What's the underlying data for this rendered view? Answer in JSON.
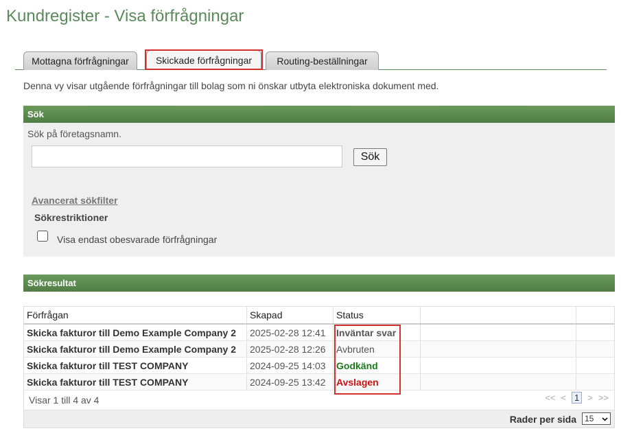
{
  "page_title": "Kundregister - Visa förfrågningar",
  "tabs": [
    {
      "label": "Mottagna förfrågningar",
      "active": false
    },
    {
      "label": "Skickade förfrågningar",
      "active": true
    },
    {
      "label": "Routing-beställningar",
      "active": false
    }
  ],
  "intro_text": "Denna vy visar utgående förfrågningar till bolag som ni önskar utbyta elektroniska dokument med.",
  "search": {
    "header": "Sök",
    "hint": "Sök på företagsnamn.",
    "input_value": "",
    "button_label": "Sök",
    "advanced_link": "Avancerat sökfilter",
    "restrictions_title": "Sökrestriktioner",
    "checkbox_label": "Visa endast obesvarade förfrågningar",
    "checkbox_checked": false
  },
  "results": {
    "header": "Sökresultat",
    "columns": [
      "Förfrågan",
      "Skapad",
      "Status"
    ],
    "rows": [
      {
        "request": "Skicka fakturor till Demo Example Company 2",
        "created": "2025-02-28 12:41",
        "status": "Inväntar svar",
        "status_color": "#555555"
      },
      {
        "request": "Skicka fakturor till Demo Example Company 2",
        "created": "2025-02-28 12:26",
        "status": "Avbruten",
        "status_color": "#555555"
      },
      {
        "request": "Skicka fakturor till TEST COMPANY",
        "created": "2024-09-25 14:03",
        "status": "Godkänd",
        "status_color": "#1a7a1a"
      },
      {
        "request": "Skicka fakturor till TEST COMPANY",
        "created": "2024-09-25 13:42",
        "status": "Avslagen",
        "status_color": "#d01010"
      }
    ],
    "showing_text": "Visar 1 till 4 av 4",
    "pager": {
      "first": "<<",
      "prev": "<",
      "current": "1",
      "next": ">",
      "last": ">>"
    },
    "rows_per_page_label": "Rader per sida",
    "rows_per_page_value": "15"
  },
  "colors": {
    "brand_green": "#5a8a5a",
    "highlight_red": "#d32f2f"
  }
}
